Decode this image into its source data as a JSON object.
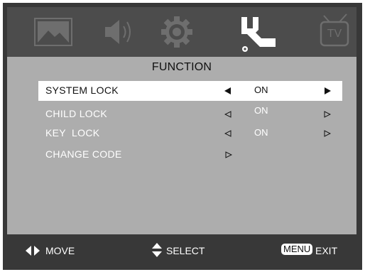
{
  "tabs": [
    {
      "icon": "picture-icon",
      "active": false
    },
    {
      "icon": "sound-icon",
      "active": false
    },
    {
      "icon": "gear-icon",
      "active": false
    },
    {
      "icon": "wrench-icon",
      "active": true
    },
    {
      "icon": "tv-icon",
      "active": false,
      "label": "TV"
    }
  ],
  "menu": {
    "title": "FUNCTION",
    "rows": [
      {
        "label": "SYSTEM LOCK",
        "value": "ON",
        "selected": true
      },
      {
        "label": "CHILD LOCK",
        "value": "ON",
        "selected": false
      },
      {
        "label": "KEY  LOCK",
        "value": "ON",
        "selected": false
      },
      {
        "label": "CHANGE CODE",
        "value": "",
        "selected": false
      }
    ]
  },
  "footer": {
    "move_label": "MOVE",
    "select_label": "SELECT",
    "menu_key": "MENU",
    "exit_label": "EXIT"
  },
  "colors": {
    "frame": "#383838",
    "tab_bar": "#4c4c4c",
    "tab_icon_inactive": "#6e6e6e",
    "tab_icon_active": "#ffffff",
    "panel": "#adadad",
    "selected_row": "#ffffff",
    "text_light": "#ffffff",
    "text_dark": "#111111"
  }
}
